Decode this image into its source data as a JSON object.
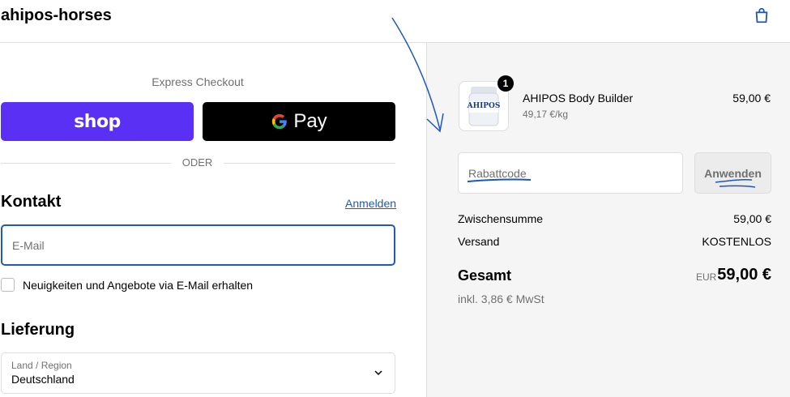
{
  "header": {
    "brand": "ahipos-horses",
    "cart_icon": "shopping-bag-icon"
  },
  "express": {
    "title": "Express Checkout",
    "shop_label": "shop",
    "gpay_label": "Pay",
    "separator": "ODER"
  },
  "contact": {
    "heading": "Kontakt",
    "signin": "Anmelden",
    "email_placeholder": "E-Mail",
    "newsletter": "Neuigkeiten und Angebote via E-Mail erhalten"
  },
  "delivery": {
    "heading": "Lieferung",
    "country_label": "Land / Region",
    "country_value": "Deutschland"
  },
  "order": {
    "quantity": "1",
    "product_name": "AHIPOS Body Builder",
    "unit_price": "49,17 €/kg",
    "price": "59,00 €",
    "product_image_text": "AHIPOS"
  },
  "discount": {
    "placeholder": "Rabattcode",
    "apply_label": "Anwenden"
  },
  "summary": {
    "subtotal_label": "Zwischensumme",
    "subtotal_value": "59,00 €",
    "shipping_label": "Versand",
    "shipping_value": "KOSTENLOS",
    "total_label": "Gesamt",
    "total_currency": "EUR",
    "total_value": "59,00 €",
    "tax_note": "inkl. 3,86 € MwSt"
  },
  "colors": {
    "shop_purple": "#5a31f4",
    "link_blue": "#1f5ab6",
    "sidebar_bg": "#f5f5f5",
    "annotation_blue": "#1a56c4"
  }
}
